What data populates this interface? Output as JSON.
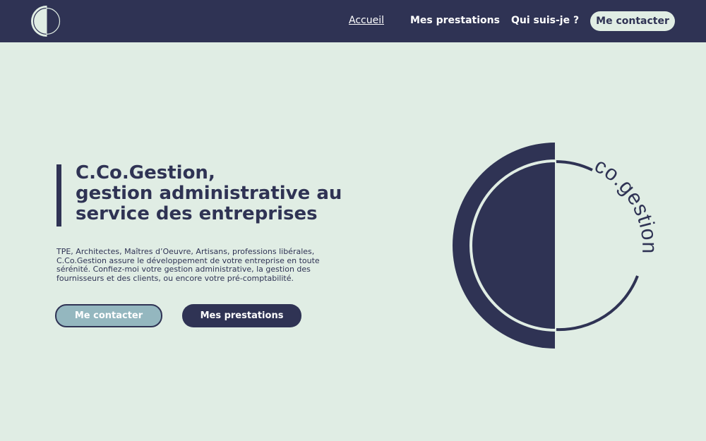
{
  "header": {
    "background_color": "#2f3354",
    "logo_icon": "cogestion-logo-icon",
    "nav": [
      {
        "label": "Accueil",
        "active": true
      },
      {
        "label": "Mes prestations",
        "active": false
      },
      {
        "label": "Qui suis-je ?",
        "active": false
      }
    ],
    "contact_button": "Me contacter"
  },
  "hero": {
    "title_lines": [
      "C.Co.Gestion,",
      "gestion administrative au",
      "service des entreprises"
    ],
    "description_lines": [
      "TPE, Architectes, Maîtres d’Oeuvre, Artisans, professions libérales,",
      "C.Co.Gestion assure le développement de votre entreprise en toute",
      "sérénité. Confiez-moi votre gestion administrative, la gestion des",
      "fournisseurs et des clients, ou encore votre pré-comptabilité."
    ],
    "primary_button": "Me contacter",
    "secondary_button": "Mes prestations"
  },
  "brand_graphic": {
    "icon": "cogestion-logo-icon",
    "wordmark": "co.gestion"
  },
  "colors": {
    "navy": "#2f3354",
    "mint_background": "#e0ede4",
    "button_blue": "#94b7bf"
  }
}
